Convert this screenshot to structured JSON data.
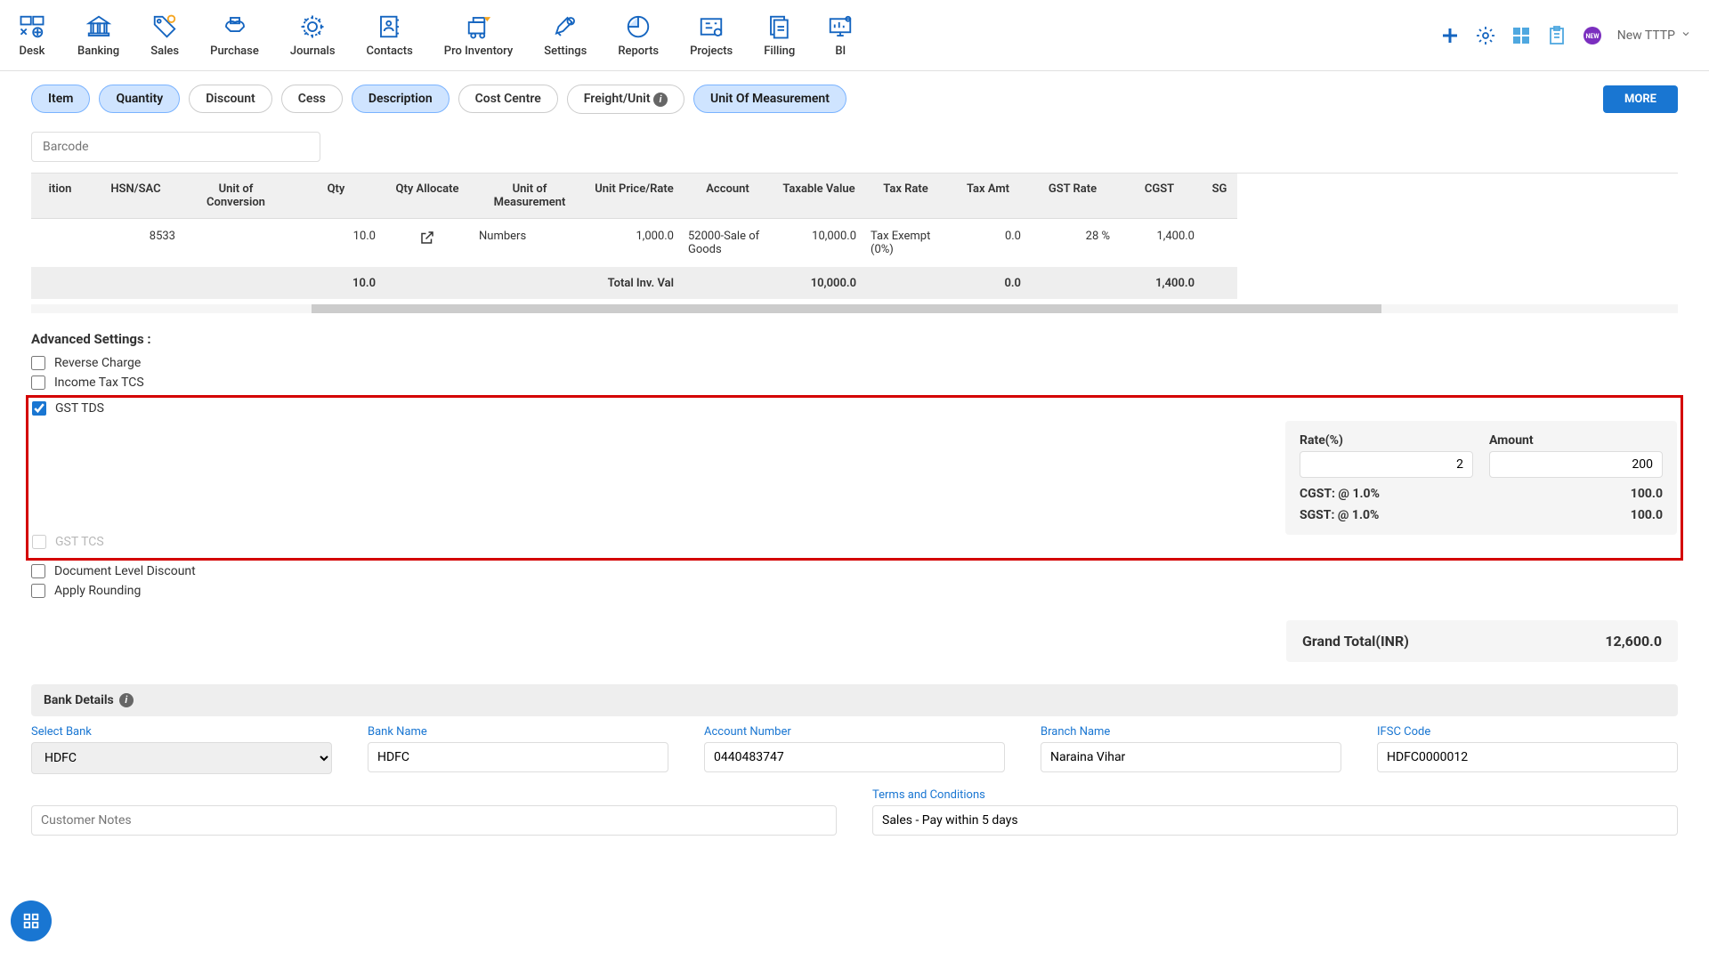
{
  "nav": {
    "items": [
      {
        "label": "Desk"
      },
      {
        "label": "Banking"
      },
      {
        "label": "Sales"
      },
      {
        "label": "Purchase"
      },
      {
        "label": "Journals"
      },
      {
        "label": "Contacts"
      },
      {
        "label": "Pro Inventory"
      },
      {
        "label": "Settings"
      },
      {
        "label": "Reports"
      },
      {
        "label": "Projects"
      },
      {
        "label": "Filling"
      },
      {
        "label": "BI"
      }
    ],
    "user": "New TTTP"
  },
  "pills": {
    "item": "Item",
    "quantity": "Quantity",
    "discount": "Discount",
    "cess": "Cess",
    "description": "Description",
    "cost_centre": "Cost Centre",
    "freight": "Freight/Unit",
    "uom": "Unit Of Measurement",
    "more": "MORE"
  },
  "barcode_placeholder": "Barcode",
  "table": {
    "headers": {
      "desc": "ition",
      "hsn": "HSN/SAC",
      "uoc": "Unit of Conversion",
      "qty": "Qty",
      "qtyalloc": "Qty Allocate",
      "uom": "Unit of Measurement",
      "rate": "Unit Price/Rate",
      "account": "Account",
      "taxable": "Taxable Value",
      "taxrate": "Tax Rate",
      "taxamt": "Tax Amt",
      "gstrate": "GST Rate",
      "cgst": "CGST",
      "sgst": "SG"
    },
    "row": {
      "hsn": "8533",
      "qty": "10.0",
      "uom": "Numbers",
      "rate": "1,000.0",
      "account": "52000-Sale of Goods",
      "taxable": "10,000.0",
      "taxrate": "Tax Exempt (0%)",
      "taxamt": "0.0",
      "gstrate": "28 %",
      "cgst": "1,400.0"
    },
    "footer": {
      "qty": "10.0",
      "label": "Total Inv. Val",
      "taxable": "10,000.0",
      "taxamt": "0.0",
      "cgst": "1,400.0"
    }
  },
  "adv": {
    "title": "Advanced Settings :",
    "reverse": "Reverse Charge",
    "itcs": "Income Tax TCS",
    "gsttds": "GST TDS",
    "gsttcs": "GST TCS",
    "docdisc": "Document Level Discount",
    "rounding": "Apply Rounding"
  },
  "tds": {
    "rate_label": "Rate(%)",
    "rate_val": "2",
    "amt_label": "Amount",
    "amt_val": "200",
    "cgst_label": "CGST: @ 1.0%",
    "cgst_val": "100.0",
    "sgst_label": "SGST: @ 1.0%",
    "sgst_val": "100.0"
  },
  "grand": {
    "label": "Grand Total(INR)",
    "value": "12,600.0"
  },
  "bank": {
    "header": "Bank Details",
    "select_label": "Select Bank",
    "select_val": "HDFC",
    "name_label": "Bank Name",
    "name_val": "HDFC",
    "acct_label": "Account Number",
    "acct_val": "0440483747",
    "branch_label": "Branch Name",
    "branch_val": "Naraina Vihar",
    "ifsc_label": "IFSC Code",
    "ifsc_val": "HDFC0000012"
  },
  "terms": {
    "notes_placeholder": "Customer Notes",
    "terms_label": "Terms and Conditions",
    "terms_val": "Sales - Pay within 5 days"
  }
}
